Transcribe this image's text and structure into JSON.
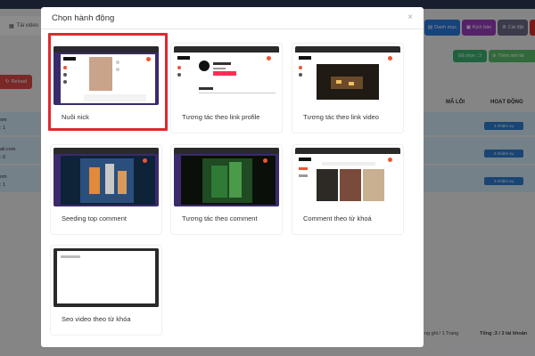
{
  "background": {
    "tab_label": "Tài video",
    "toolbar_buttons": [
      {
        "label": "Danh mục",
        "color": "#2b7be0"
      },
      {
        "label": "Kịch bản",
        "color": "#9b3fbf"
      },
      {
        "label": "Cài đặt",
        "color": "#6c6c8a"
      }
    ],
    "reload_label": "Reload",
    "selected_label": "Đã chọn : 3",
    "add_account_label": "Thêm mới tài",
    "col_error": "MÃ LỖI",
    "col_activity": "HOẠT ĐỘNG",
    "rows": [
      {
        "line1": "om",
        "line2": ": 1",
        "status": "3 nhiệm vụ"
      },
      {
        "line1": "ail.com",
        "line2": ": 0",
        "status": "3 nhiệm vụ"
      },
      {
        "line1": "om",
        "line2": ": 1",
        "status": "3 nhiệm vụ"
      }
    ],
    "footer_pager": "ng ghi / 1 Trang",
    "footer_total": "Tổng :3 / 3 tài khoản"
  },
  "modal": {
    "title": "Chọn hành động",
    "close_glyph": "×",
    "actions": [
      {
        "label": "Nuôi nick"
      },
      {
        "label": "Tương tác theo link profile"
      },
      {
        "label": "Tương tác theo link video"
      },
      {
        "label": "Seeding top comment"
      },
      {
        "label": "Tương tác theo comment"
      },
      {
        "label": "Comment theo từ khoá"
      },
      {
        "label": "Seo video theo từ khóa"
      }
    ],
    "selected_index": 0
  },
  "colors": {
    "accent_red": "#e0282e",
    "row_highlight": "#d6ecf7",
    "status_blue": "#2d7fd3"
  }
}
